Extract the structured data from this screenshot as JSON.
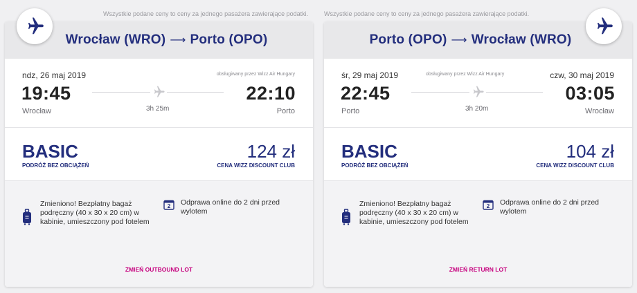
{
  "notice": "Wszystkie podane ceny to ceny za jednego pasażera zawierające podatki.",
  "colors": {
    "brand_blue": "#232e7d",
    "accent_pink": "#c6007e"
  },
  "outbound": {
    "origin": "Wrocław (WRO)",
    "destination": "Porto (OPO)",
    "arrow": "⟶",
    "depart_date": "ndz, 26 maj 2019",
    "arrive_date": "",
    "operator": "obsługiwany przez Wizz Air Hungary",
    "depart_time": "19:45",
    "arrive_time": "22:10",
    "depart_city": "Wrocław",
    "arrive_city": "Porto",
    "duration": "3h 25m",
    "fare_name": "BASIC",
    "fare_sub": "PODRÓŻ BEZ OBCIĄŻEŃ",
    "price": "124 zł",
    "price_sub": "CENA WIZZ DISCOUNT CLUB",
    "bag_text": "Zmieniono! Bezpłatny bagaż podręczny (40 x 30 x 20 cm) w kabinie, umieszczony pod fotelem",
    "checkin_text": "Odprawa online do 2 dni przed wylotem",
    "checkin_icon_number": "2",
    "change_label": "ZMIEŃ OUTBOUND LOT",
    "badge_icon": "plane-icon"
  },
  "return": {
    "origin": "Porto (OPO)",
    "destination": "Wrocław (WRO)",
    "arrow": "⟶",
    "depart_date": "śr, 29 maj 2019",
    "arrive_date": "czw, 30 maj 2019",
    "operator": "obsługiwany przez Wizz Air Hungary",
    "depart_time": "22:45",
    "arrive_time": "03:05",
    "depart_city": "Porto",
    "arrive_city": "Wrocław",
    "duration": "3h 20m",
    "fare_name": "BASIC",
    "fare_sub": "PODRÓŻ BEZ OBCIĄŻEŃ",
    "price": "104 zł",
    "price_sub": "CENA WIZZ DISCOUNT CLUB",
    "bag_text": "Zmieniono! Bezpłatny bagaż podręczny (40 x 30 x 20 cm) w kabinie, umieszczony pod fotelem",
    "checkin_text": "Odprawa online do 2 dni przed wylotem",
    "checkin_icon_number": "2",
    "change_label": "ZMIEŃ RETURN LOT",
    "badge_icon": "plane-icon"
  }
}
